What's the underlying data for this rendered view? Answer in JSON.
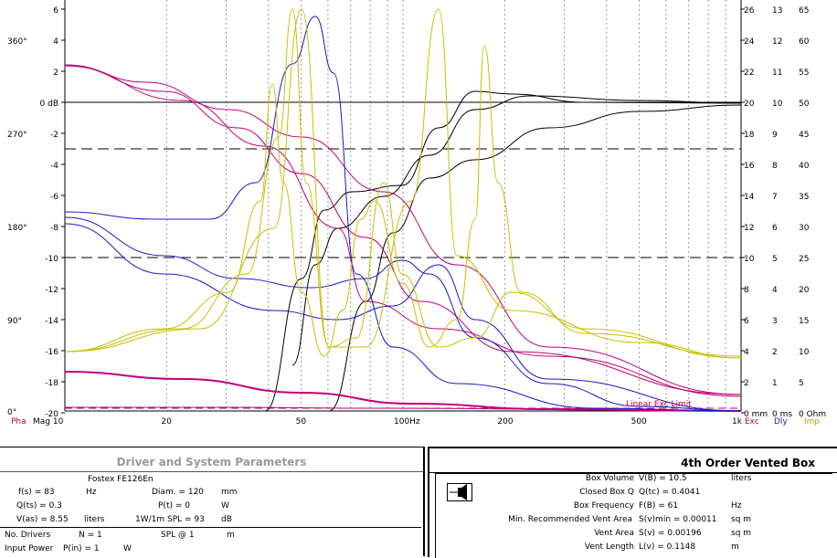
{
  "plot": {
    "left_axis_db": [
      "6",
      "4",
      "2",
      "0 dB",
      "-2",
      "-4",
      "-6",
      "-8",
      "-10",
      "-12",
      "-14",
      "-16",
      "-18",
      "-20"
    ],
    "phase_labels": [
      "360°",
      "270°",
      "180°",
      "90°",
      "0°"
    ],
    "freq_labels": [
      "Mag 10",
      "20",
      "50",
      "100Hz",
      "200",
      "500",
      "1k"
    ],
    "pha_label": "Pha",
    "right_col1": [
      "26",
      "24",
      "22",
      "20",
      "18",
      "16",
      "14",
      "12",
      "10",
      "8",
      "6",
      "4",
      "2",
      "0 mm"
    ],
    "right_col2": [
      "13",
      "12",
      "11",
      "10",
      "9",
      "8",
      "7",
      "6",
      "5",
      "4",
      "3",
      "2",
      "1",
      "0 ms"
    ],
    "right_col3": [
      "65",
      "60",
      "55",
      "50",
      "45",
      "40",
      "35",
      "30",
      "25",
      "20",
      "15",
      "10",
      "5",
      "0 Ohm"
    ],
    "exc_label": "Exc",
    "dly_label": "Dly",
    "imp_label": "Imp",
    "linear_exc_limit": "Linear Exc Limit",
    "colors": {
      "magnitude": "#000000",
      "phase": "#c0007a",
      "delay": "#1818c8",
      "impedance": "#c8c000",
      "grid": "#999999"
    }
  },
  "driver_panel": {
    "title": "Driver and System Parameters",
    "driver_name": "Fostex FE126En",
    "fs_label": "f(s) = 83",
    "fs_unit": "Hz",
    "qts_label": "Q(ts) = 0.3",
    "vas_label": "V(as) = 8.55",
    "vas_unit": "liters",
    "diam_label": "Diam. = 120",
    "diam_unit": "mm",
    "pt_label": "P(t) = 0",
    "pt_unit": "W",
    "spl_label": "1W/1m SPL = 93",
    "spl_unit": "dB",
    "drivers_label": "No. Drivers",
    "drivers_value": "N = 1",
    "spl_at_label": "SPL @ 1",
    "spl_at_unit": "m",
    "power_label": "Input Power",
    "power_value": "P(in) = 1",
    "power_unit": "W"
  },
  "box_panel": {
    "title": "4th Order Vented Box",
    "rows": [
      {
        "label": "Box Volume",
        "value": "V(B) = 10.5",
        "unit": "liters"
      },
      {
        "label": "Closed Box Q",
        "value": "Q(tc) = 0.4041",
        "unit": ""
      },
      {
        "label": "Box Frequency",
        "value": "F(B) = 61",
        "unit": "Hz"
      },
      {
        "label": "Min. Recommended Vent Area",
        "value": "S(v)min = 0.00011",
        "unit": "sq m"
      },
      {
        "label": "Vent Area",
        "value": "S(v) = 0.00196",
        "unit": "sq m"
      },
      {
        "label": "Vent Length",
        "value": "L(v) = 0.1148",
        "unit": "m"
      }
    ]
  }
}
